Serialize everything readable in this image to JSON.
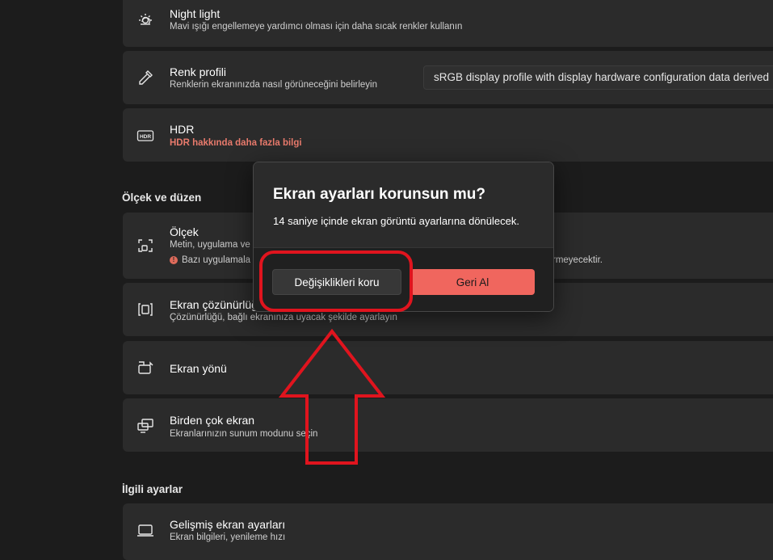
{
  "settings": {
    "night_light": {
      "title": "Night light",
      "sub": "Mavi ışığı engellemeye yardımcı olması için daha sıcak renkler kullanın",
      "icon": "sun-icon"
    },
    "color_profile": {
      "title": "Renk profili",
      "sub": "Renklerin ekranınızda nasıl görüneceğini belirleyin",
      "dropdown": "sRGB display profile with display hardware configuration data derived",
      "icon": "eyedropper-icon"
    },
    "hdr": {
      "title": "HDR",
      "link": "HDR hakkında daha fazla bilgi",
      "icon": "hdr-icon"
    },
    "scale_section": "Ölçek ve düzen",
    "scale": {
      "title": "Ölçek",
      "sub": "Metin, uygulama ve",
      "warning_left": "Bazı uygulamala",
      "warning_right": "rmeyecektir.",
      "icon": "scale-icon"
    },
    "resolution": {
      "title": "Ekran çözünürlüğ",
      "sub": "Çözünürlüğü, bağlı ekranınıza uyacak şekilde ayarlayın",
      "icon": "resolution-icon"
    },
    "orientation": {
      "title": "Ekran yönü",
      "icon": "orientation-icon"
    },
    "multi": {
      "title": "Birden çok ekran",
      "sub": "Ekranlarınızın sunum modunu seçin",
      "icon": "multi-display-icon"
    },
    "related_section": "İlgili ayarlar",
    "advanced": {
      "title": "Gelişmiş ekran ayarları",
      "sub": "Ekran bilgileri, yenileme hızı",
      "icon": "monitor-icon"
    }
  },
  "dialog": {
    "title": "Ekran ayarları korunsun mu?",
    "message": "14 saniye içinde ekran görüntü ayarlarına dönülecek.",
    "keep_label": "Değişiklikleri koru",
    "revert_label": "Geri Al"
  },
  "colors": {
    "accent": "#f0665e",
    "annotation": "#e0141e",
    "card": "#2b2b2b",
    "background": "#1c1c1c"
  }
}
